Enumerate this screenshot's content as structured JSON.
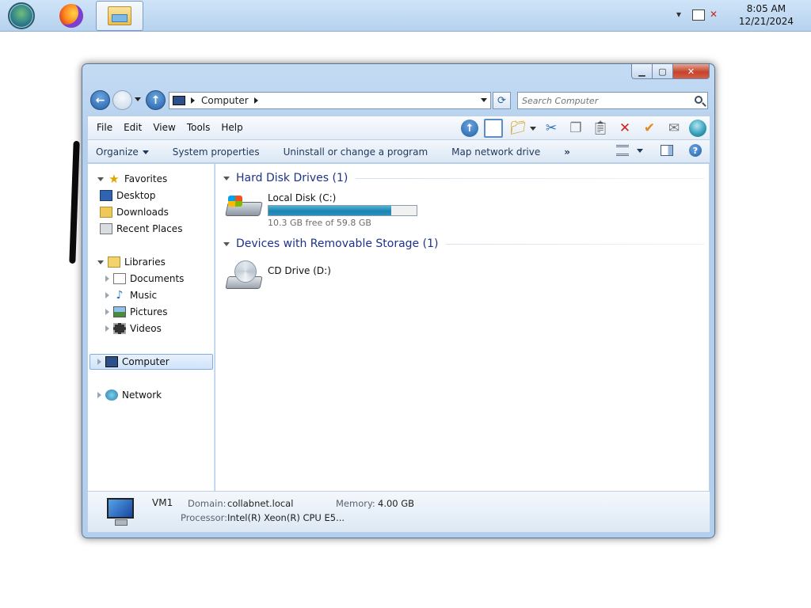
{
  "taskbar": {
    "clock_time": "8:05 AM",
    "clock_date": "12/21/2024",
    "apps": [
      {
        "name": "start-button"
      },
      {
        "name": "firefox"
      },
      {
        "name": "windows-explorer",
        "active": true
      }
    ],
    "tray_icons": [
      "show-hidden-icons-arrow",
      "network-icon",
      "volume-muted-icon"
    ]
  },
  "window": {
    "caption_buttons": [
      "minimize",
      "maximize",
      "close"
    ],
    "close_glyph": "✕",
    "address": {
      "location": "Computer"
    },
    "search": {
      "placeholder": "Search Computer"
    },
    "menu": [
      "File",
      "Edit",
      "View",
      "Tools",
      "Help"
    ],
    "toolbar_icons": [
      "up-icon",
      "pane-icon",
      "folder-icon",
      "cut-icon",
      "copy-icon",
      "paste-icon",
      "delete-icon",
      "check-icon",
      "mail-icon",
      "globe-icon"
    ],
    "command_bar": {
      "organize": "Organize",
      "system_properties": "System properties",
      "uninstall": "Uninstall or change a program",
      "map_drive": "Map network drive",
      "more": "»"
    },
    "navigation": {
      "favorites": "Favorites",
      "favorites_items": [
        "Desktop",
        "Downloads",
        "Recent Places"
      ],
      "libraries": "Libraries",
      "libraries_items": [
        "Documents",
        "Music",
        "Pictures",
        "Videos"
      ],
      "computer": "Computer",
      "network": "Network"
    },
    "content": {
      "groups": [
        {
          "title": "Hard Disk Drives (1)",
          "drives": [
            {
              "name": "Local Disk (C:)",
              "free_text": "10.3 GB free of 59.8 GB",
              "used_fraction": 0.828
            }
          ]
        },
        {
          "title": "Devices with Removable Storage (1)",
          "drives": [
            {
              "name": "CD Drive (D:)"
            }
          ]
        }
      ]
    },
    "details": {
      "name": "VM1",
      "domain_label": "Domain:",
      "domain_value": "collabnet.local",
      "memory_label": "Memory:",
      "memory_value": "4.00 GB",
      "processor_label": "Processor:",
      "processor_value": "Intel(R) Xeon(R) CPU E5..."
    }
  },
  "colors": {
    "group_title": "#1e3287",
    "command_text": "#1e395b",
    "selection_border": "#84acdd"
  }
}
